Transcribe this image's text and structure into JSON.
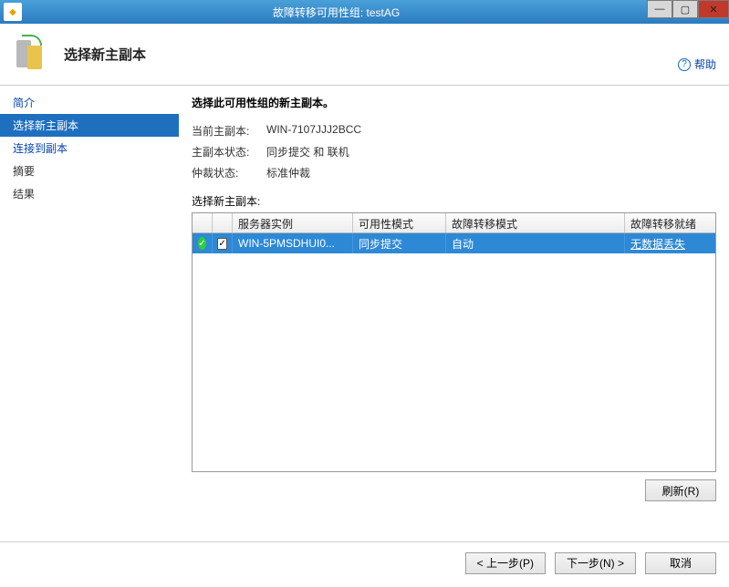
{
  "window": {
    "title": "故障转移可用性组: testAG"
  },
  "header": {
    "page_title": "选择新主副本"
  },
  "help": {
    "label": "帮助"
  },
  "sidebar": {
    "items": [
      {
        "label": "简介",
        "kind": "link"
      },
      {
        "label": "选择新主副本",
        "kind": "selected"
      },
      {
        "label": "连接到副本",
        "kind": "link"
      },
      {
        "label": "摘要",
        "kind": "plain"
      },
      {
        "label": "结果",
        "kind": "plain"
      }
    ]
  },
  "main": {
    "instruction": "选择此可用性组的新主副本。",
    "info": [
      {
        "label": "当前主副本:",
        "value": "WIN-7107JJJ2BCC"
      },
      {
        "label": "主副本状态:",
        "value": "同步提交 和 联机"
      },
      {
        "label": "仲裁状态:",
        "value": "标准仲裁"
      }
    ],
    "select_label": "选择新主副本:",
    "columns": {
      "server": "服务器实例",
      "availability_mode": "可用性模式",
      "failover_mode": "故障转移模式",
      "readiness": "故障转移就绪"
    },
    "rows": [
      {
        "checked": true,
        "server": "WIN-5PMSDHUI0...",
        "availability_mode": "同步提交",
        "failover_mode": "自动",
        "readiness": "无数据丢失"
      }
    ],
    "refresh": "刷新(R)"
  },
  "footer": {
    "prev": "< 上一步(P)",
    "next": "下一步(N) >",
    "cancel": "取消"
  }
}
